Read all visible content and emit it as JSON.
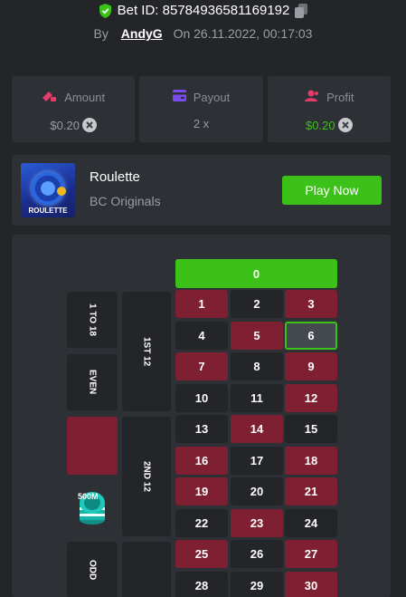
{
  "header": {
    "bet_id": "Bet ID: 85784936581169192",
    "by": "By",
    "user": "AndyG",
    "on": "On",
    "date": "26.11.2022, 00:17:03"
  },
  "stats": {
    "amount_title": "Amount",
    "amount_value": "$0.20",
    "payout_title": "Payout",
    "payout_value": "2 x",
    "profit_title": "Profit",
    "profit_value": "$0.20"
  },
  "game": {
    "thumb_label": "ROULETTE",
    "name": "Roulette",
    "provider": "BC Originals",
    "play_label": "Play Now"
  },
  "board": {
    "zero": "0",
    "numbers": [
      {
        "n": "1",
        "c": "red"
      },
      {
        "n": "2",
        "c": "black"
      },
      {
        "n": "3",
        "c": "red"
      },
      {
        "n": "4",
        "c": "black"
      },
      {
        "n": "5",
        "c": "red"
      },
      {
        "n": "6",
        "c": "selected"
      },
      {
        "n": "7",
        "c": "red"
      },
      {
        "n": "8",
        "c": "black"
      },
      {
        "n": "9",
        "c": "red"
      },
      {
        "n": "10",
        "c": "black"
      },
      {
        "n": "11",
        "c": "black"
      },
      {
        "n": "12",
        "c": "red"
      },
      {
        "n": "13",
        "c": "black"
      },
      {
        "n": "14",
        "c": "red"
      },
      {
        "n": "15",
        "c": "black"
      },
      {
        "n": "16",
        "c": "red"
      },
      {
        "n": "17",
        "c": "black"
      },
      {
        "n": "18",
        "c": "red"
      },
      {
        "n": "19",
        "c": "red"
      },
      {
        "n": "20",
        "c": "black"
      },
      {
        "n": "21",
        "c": "red"
      },
      {
        "n": "22",
        "c": "black"
      },
      {
        "n": "23",
        "c": "red"
      },
      {
        "n": "24",
        "c": "black"
      },
      {
        "n": "25",
        "c": "red"
      },
      {
        "n": "26",
        "c": "black"
      },
      {
        "n": "27",
        "c": "red"
      },
      {
        "n": "28",
        "c": "black"
      },
      {
        "n": "29",
        "c": "black"
      },
      {
        "n": "30",
        "c": "red"
      }
    ],
    "dozen_1": "1ST 12",
    "dozen_2": "2ND 12",
    "low": "1 TO 18",
    "even": "EVEN",
    "odd": "ODD",
    "chip_label": "500M"
  },
  "colors": {
    "green": "#3bc117",
    "red": "#7e1f32",
    "panel": "#2d3035",
    "bg": "#232528"
  }
}
